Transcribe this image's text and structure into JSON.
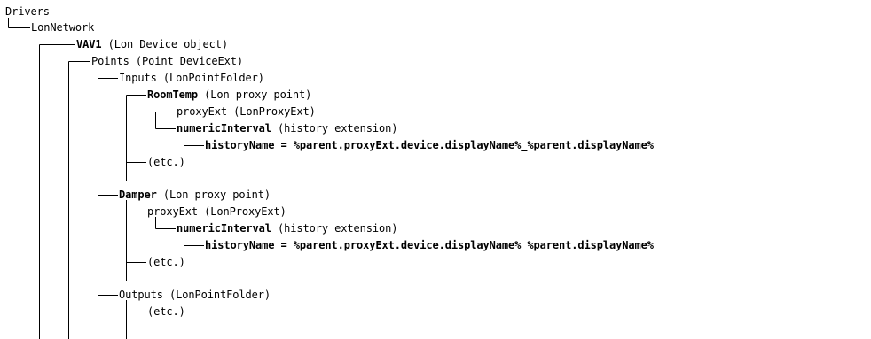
{
  "tree": {
    "nodes": [
      {
        "bold": "",
        "text": "Drivers"
      },
      {
        "bold": "",
        "text": "LonNetwork"
      },
      {
        "bold": "VAV1",
        "text": " (Lon Device object)"
      },
      {
        "bold": "",
        "text": "Points (Point DeviceExt)"
      },
      {
        "bold": "",
        "text": "Inputs (LonPointFolder)"
      },
      {
        "bold": "RoomTemp",
        "text": " (Lon proxy point)"
      },
      {
        "bold": "",
        "text": "proxyExt (LonProxyExt)"
      },
      {
        "bold": "numericInterval",
        "text": " (history extension)"
      },
      {
        "bold": "historyName = %parent.proxyExt.device.displayName%_%parent.displayName%",
        "text": ""
      },
      {
        "bold": "",
        "text": "(etc.)"
      },
      {
        "bold": "Damper",
        "text": " (Lon proxy point)"
      },
      {
        "bold": "",
        "text": "proxyExt (LonProxyExt)"
      },
      {
        "bold": "numericInterval",
        "text": " (history extension)"
      },
      {
        "bold": "historyName = %parent.proxyExt.device.displayName% %parent.displayName%",
        "text": ""
      },
      {
        "bold": "",
        "text": "(etc.)"
      },
      {
        "bold": "",
        "text": "Outputs (LonPointFolder)"
      },
      {
        "bold": "",
        "text": "(etc.)"
      }
    ]
  }
}
